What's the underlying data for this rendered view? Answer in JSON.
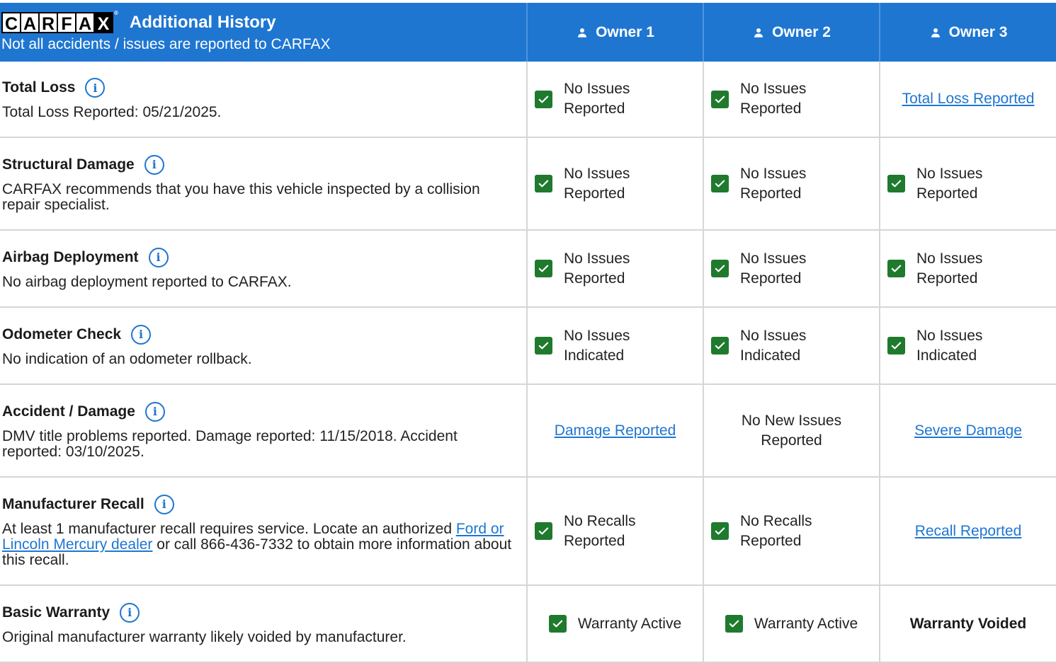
{
  "header": {
    "logo_letters": [
      "C",
      "A",
      "R",
      "F",
      "A",
      "X"
    ],
    "logo_tm": "®",
    "title": "Additional History",
    "subtitle": "Not all accidents / issues are reported to CARFAX",
    "owners": [
      "Owner 1",
      "Owner 2",
      "Owner 3"
    ]
  },
  "colors": {
    "brand_blue": "#1e76d1",
    "check_green": "#1f7a2e",
    "divider": "#d6d6d6"
  },
  "info_icon_glyph": "i",
  "rows": [
    {
      "title": "Total Loss",
      "desc": "Total Loss Reported: 05/21/2025.",
      "cells": [
        {
          "type": "check",
          "text": "No Issues\nReported"
        },
        {
          "type": "check",
          "text": "No Issues\nReported"
        },
        {
          "type": "link",
          "text": "Total Loss Reported"
        }
      ]
    },
    {
      "title": "Structural Damage",
      "desc": "CARFAX recommends that you have this vehicle inspected by a collision repair specialist.",
      "cells": [
        {
          "type": "check",
          "text": "No Issues\nReported"
        },
        {
          "type": "check",
          "text": "No Issues\nReported"
        },
        {
          "type": "check",
          "text": "No Issues\nReported"
        }
      ]
    },
    {
      "title": "Airbag Deployment",
      "desc": "No airbag deployment reported to CARFAX.",
      "cells": [
        {
          "type": "check",
          "text": "No Issues\nReported"
        },
        {
          "type": "check",
          "text": "No Issues\nReported"
        },
        {
          "type": "check",
          "text": "No Issues\nReported"
        }
      ]
    },
    {
      "title": "Odometer Check",
      "desc": "No indication of an odometer rollback.",
      "cells": [
        {
          "type": "check",
          "text": "No Issues\nIndicated"
        },
        {
          "type": "check",
          "text": "No Issues\nIndicated"
        },
        {
          "type": "check",
          "text": "No Issues\nIndicated"
        }
      ]
    },
    {
      "title": "Accident / Damage",
      "desc": "DMV title problems reported. Damage reported: 11/15/2018. Accident reported: 03/10/2025.",
      "cells": [
        {
          "type": "link",
          "text": "Damage Reported"
        },
        {
          "type": "plain",
          "text": "No New Issues\nReported"
        },
        {
          "type": "link",
          "text": "Severe Damage"
        }
      ]
    },
    {
      "title": "Manufacturer Recall",
      "desc_before": "At least 1 manufacturer recall requires service. Locate an authorized ",
      "desc_link": "Ford or Lincoln Mercury dealer",
      "desc_after": " or call 866-436-7332 to obtain more information about this recall.",
      "cells": [
        {
          "type": "check",
          "text": "No Recalls\nReported"
        },
        {
          "type": "check",
          "text": "No Recalls\nReported"
        },
        {
          "type": "link",
          "text": "Recall Reported"
        }
      ]
    },
    {
      "title": "Basic Warranty",
      "desc": "Original manufacturer warranty likely voided by manufacturer.",
      "cells": [
        {
          "type": "check-center",
          "text": "Warranty Active"
        },
        {
          "type": "check-center",
          "text": "Warranty Active"
        },
        {
          "type": "bold",
          "text": "Warranty Voided"
        }
      ]
    }
  ]
}
